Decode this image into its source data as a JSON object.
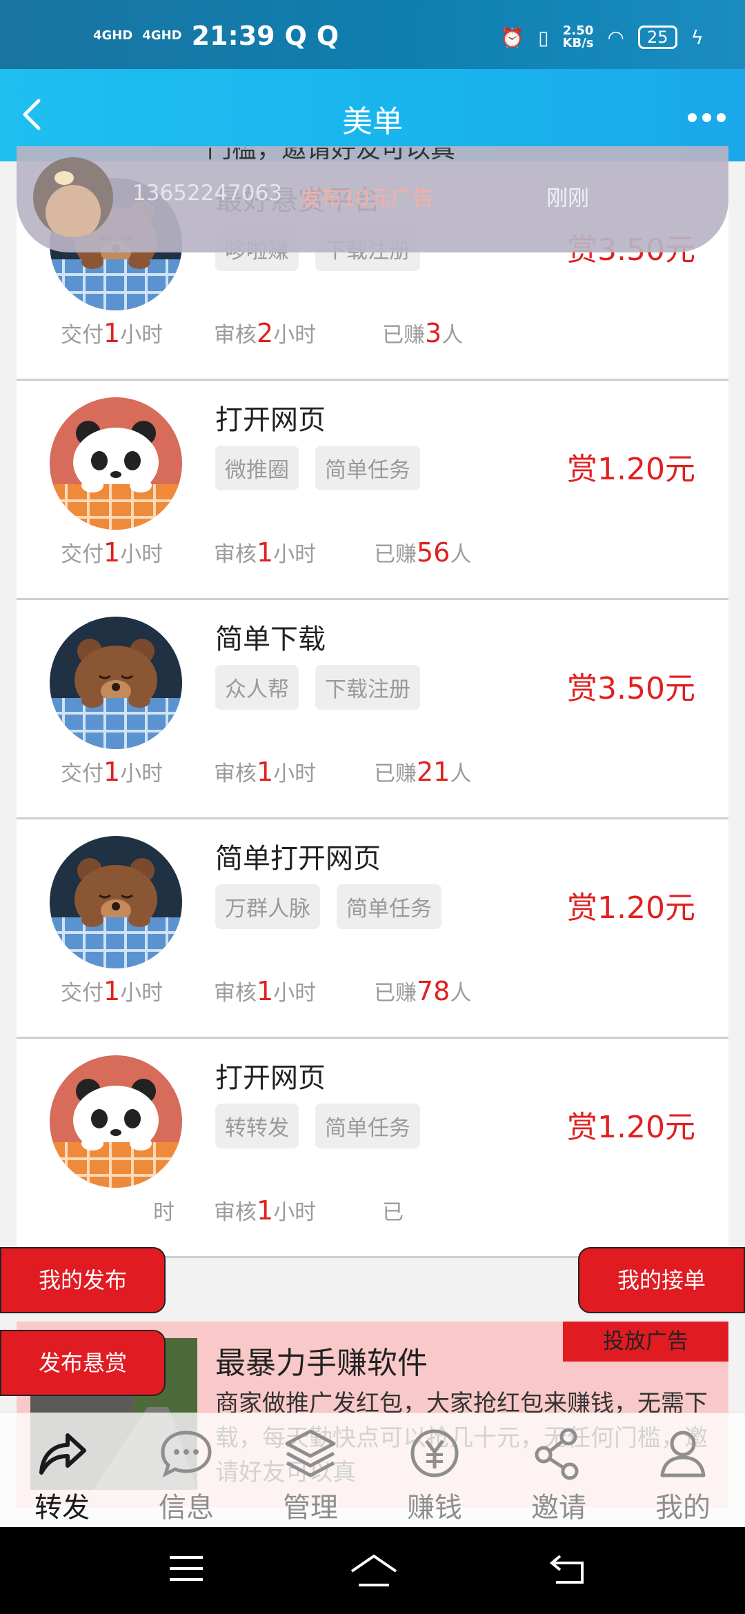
{
  "status_bar": {
    "net1": "4GHD",
    "net2": "4GHD",
    "time": "21:39",
    "speed": "2.50",
    "speed_unit": "KB/s",
    "battery": "25"
  },
  "header": {
    "title": "美单"
  },
  "notification": {
    "prev_text": "门槛，邀请好友可以真",
    "phone": "13652247063",
    "action": "发布10元广告",
    "time": "刚刚"
  },
  "tasks": [
    {
      "title": "最好悬赏平台",
      "tags": [
        "哆啦赚",
        "下载注册"
      ],
      "reward": "赏3.50元",
      "pay_label": "交付",
      "pay_num": "1",
      "pay_unit": "小时",
      "review_label": "审核",
      "review_num": "2",
      "review_unit": "小时",
      "earned_label": "已赚",
      "earned_num": "3",
      "earned_unit": "人",
      "avatar": "bear"
    },
    {
      "title": "打开网页",
      "tags": [
        "微推圈",
        "简单任务"
      ],
      "reward": "赏1.20元",
      "pay_label": "交付",
      "pay_num": "1",
      "pay_unit": "小时",
      "review_label": "审核",
      "review_num": "1",
      "review_unit": "小时",
      "earned_label": "已赚",
      "earned_num": "56",
      "earned_unit": "人",
      "avatar": "panda"
    },
    {
      "title": "简单下载",
      "tags": [
        "众人帮",
        "下载注册"
      ],
      "reward": "赏3.50元",
      "pay_label": "交付",
      "pay_num": "1",
      "pay_unit": "小时",
      "review_label": "审核",
      "review_num": "1",
      "review_unit": "小时",
      "earned_label": "已赚",
      "earned_num": "21",
      "earned_unit": "人",
      "avatar": "bear"
    },
    {
      "title": "简单打开网页",
      "tags": [
        "万群人脉",
        "简单任务"
      ],
      "reward": "赏1.20元",
      "pay_label": "交付",
      "pay_num": "1",
      "pay_unit": "小时",
      "review_label": "审核",
      "review_num": "1",
      "review_unit": "小时",
      "earned_label": "已赚",
      "earned_num": "78",
      "earned_unit": "人",
      "avatar": "bear"
    },
    {
      "title": "打开网页",
      "tags": [
        "转转发",
        "简单任务"
      ],
      "reward": "赏1.20元",
      "pay_label": "",
      "pay_num": "",
      "pay_unit": "时",
      "review_label": "审核",
      "review_num": "1",
      "review_unit": "小时",
      "earned_label": "已",
      "earned_num": "",
      "earned_unit": "",
      "avatar": "panda"
    }
  ],
  "floating": {
    "my_publish": "我的发布",
    "my_orders": "我的接单",
    "post_reward": "发布悬赏"
  },
  "ad": {
    "badge": "投放广告",
    "title": "最暴力手赚软件",
    "desc": "商家做推广发红包，大家抢红包来赚钱，无需下载，每天勤快点可以抢几十元，无任何门槛，邀请好友可以真"
  },
  "bottom_nav": [
    {
      "label": "转发",
      "icon": "share-icon",
      "active": true
    },
    {
      "label": "信息",
      "icon": "chat-icon",
      "active": false
    },
    {
      "label": "管理",
      "icon": "layers-icon",
      "active": false
    },
    {
      "label": "赚钱",
      "icon": "yuan-icon",
      "active": false
    },
    {
      "label": "邀请",
      "icon": "network-icon",
      "active": false
    },
    {
      "label": "我的",
      "icon": "user-icon",
      "active": false
    }
  ],
  "colors": {
    "accent_red": "#e02020",
    "header_blue": "#1fbff0",
    "ad_pink": "#f9c9c9"
  }
}
